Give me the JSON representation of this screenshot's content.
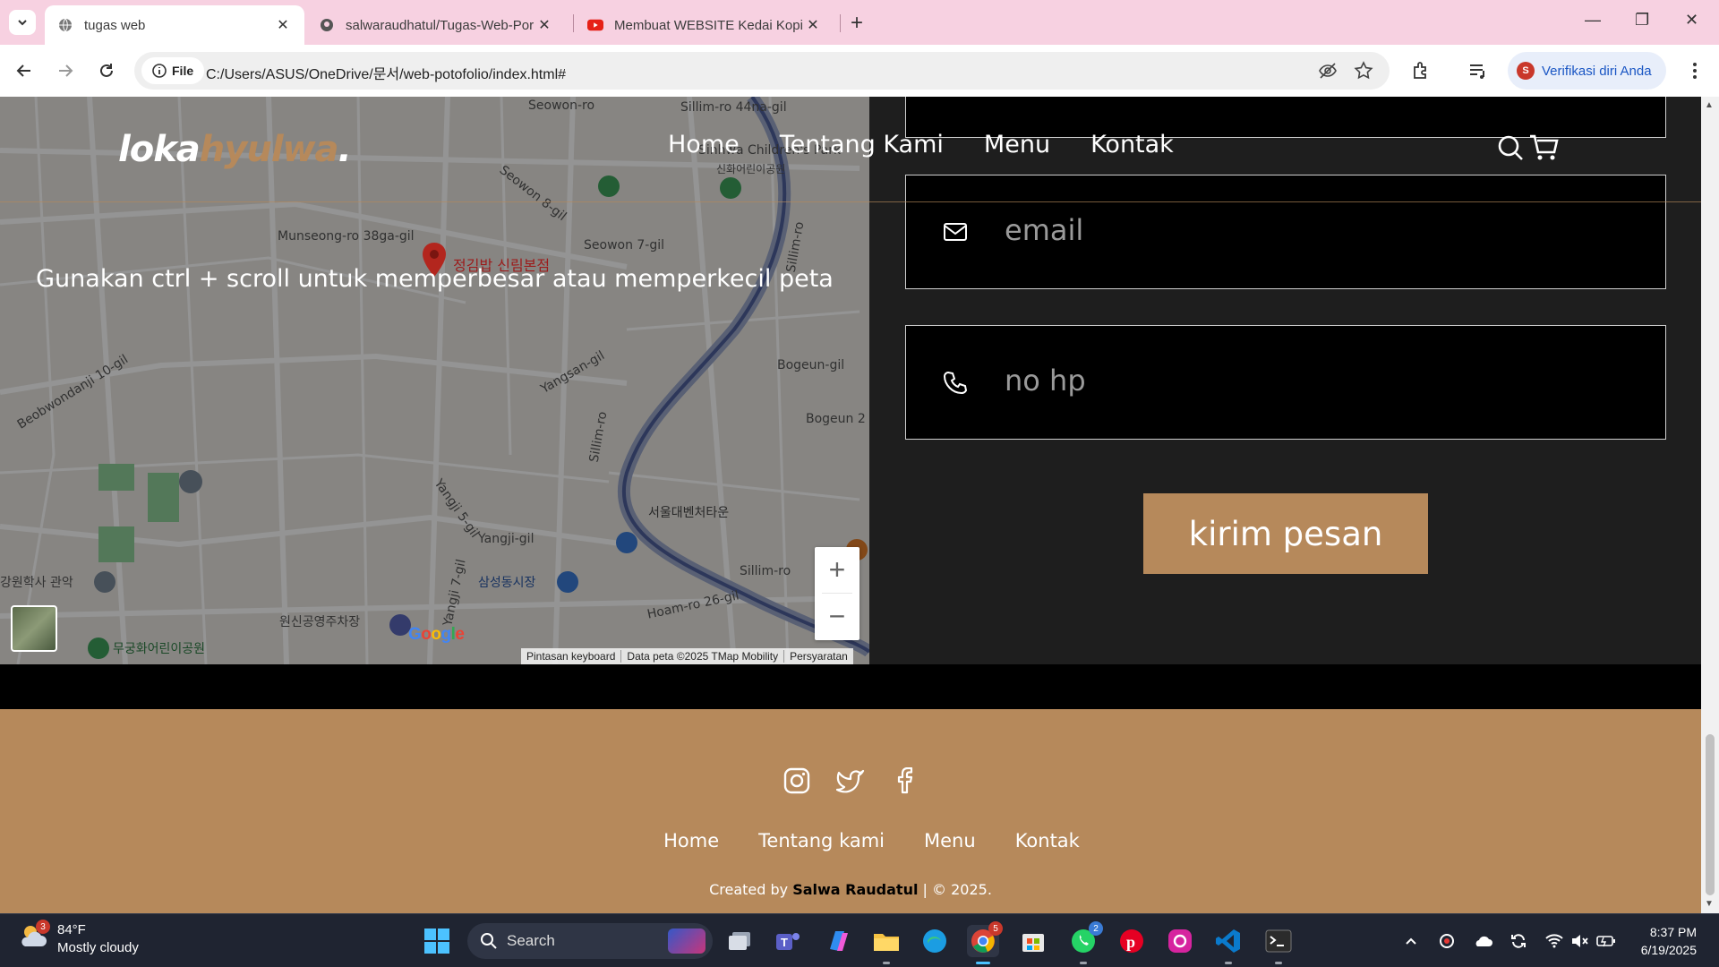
{
  "browser": {
    "tabs": [
      {
        "title": "tugas web",
        "favicon": "globe-icon",
        "active": true
      },
      {
        "title": "salwaraudhatul/Tugas-Web-Por",
        "favicon": "github-icon",
        "active": false
      },
      {
        "title": "Membuat WEBSITE Kedai Kopi I",
        "favicon": "youtube-icon",
        "active": false
      }
    ],
    "chip_label": "File",
    "url": "C:/Users/ASUS/OneDrive/문서/web-potofolio/index.html#",
    "profile_initial": "S",
    "profile_label": "Verifikasi diri Anda"
  },
  "page": {
    "logo_part1": "loka",
    "logo_part2": "hyulwa",
    "logo_dot": ".",
    "nav": [
      "Home",
      "Tentang Kami",
      "Menu",
      "Kontak"
    ],
    "map": {
      "overlay_message": "Gunakan ctrl + scroll untuk memperbesar atau memperkecil peta",
      "pin_label": "정김밥 신림본점",
      "labels": [
        "Seowon-ro",
        "Sillim-ro 44na-gil",
        "Sinhwa Children's Park",
        "신화어린이공원",
        "Munseong-ro 38ga-gil",
        "Seowon 8-gil",
        "Seowon 7-gil",
        "Sillim-ro",
        "Beobwondanji 10-gil",
        "Yangsan-gil",
        "Bogeun-gil",
        "Bogeun 2",
        "Sillim-ro",
        "서울대벤처타운",
        "Yangji 5-gil",
        "Yangji-gil",
        "Sillim-ro",
        "삼성동시장",
        "Hoam-ro 26-gil",
        "원신공영주차장",
        "무궁화어린이공원",
        "강원학사 관악",
        "Yangji 7-gil"
      ],
      "attribution": [
        "Pintasan keyboard",
        "Data peta ©2025 TMap Mobility",
        "Persyaratan"
      ],
      "google": "Google"
    },
    "form": {
      "email_placeholder": "email",
      "phone_placeholder": "no hp",
      "submit_label": "kirim pesan"
    },
    "footer": {
      "links": [
        "Home",
        "Tentang kami",
        "Menu",
        "Kontak"
      ],
      "credit_prefix": "Created by ",
      "credit_name": "Salwa Raudatul",
      "credit_suffix": " | © 2025."
    }
  },
  "taskbar": {
    "weather_temp": "84°F",
    "weather_desc": "Mostly cloudy",
    "weather_badge": "3",
    "search_label": "Search",
    "chrome_badge": "5",
    "whatsapp_badge": "2",
    "time": "8:37 PM",
    "date": "6/19/2025"
  },
  "colors": {
    "accent": "#b6895b",
    "tabbar": "#f7d1e1",
    "taskbar": "#1f2431"
  }
}
